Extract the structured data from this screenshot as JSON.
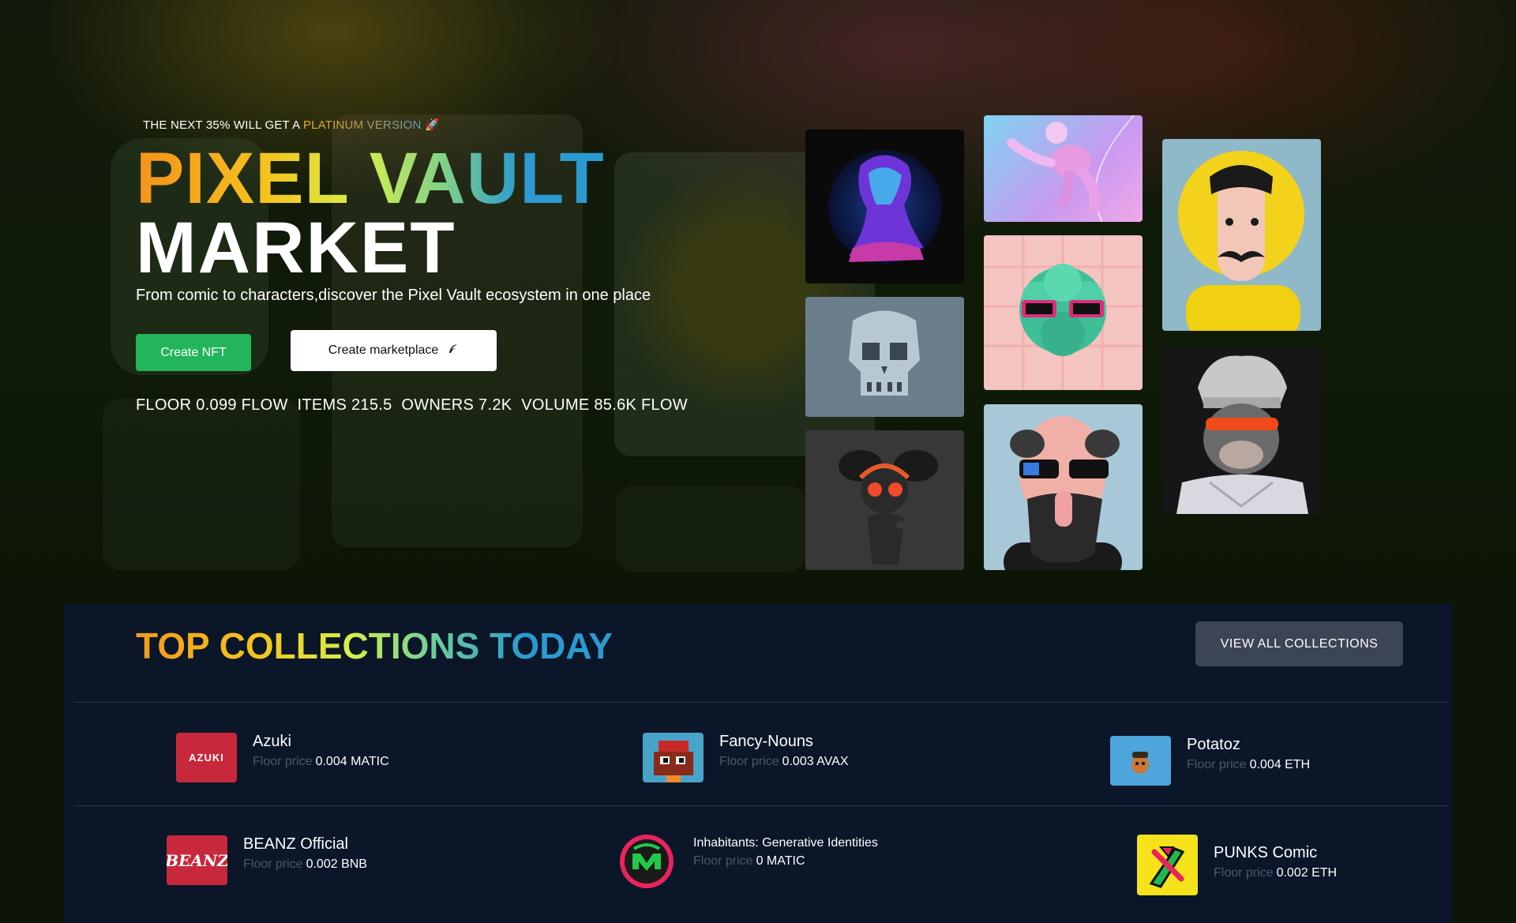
{
  "hero": {
    "promo_prefix": "THE NEXT 35% WILL GET A",
    "promo_highlight": "PLATINUM VERSION",
    "promo_emoji": "🚀",
    "title_line1": "PIXEL VAULT",
    "title_line2": "MARKET",
    "subtitle": "From comic to characters,discover the Pixel Vault ecosystem in one place",
    "create_nft_label": "Create NFT",
    "create_marketplace_label": "Create marketplace",
    "stats": {
      "floor": "FLOOR 0.099 FLOW",
      "items": "ITEMS 215.5",
      "owners": "OWNERS 7.2K",
      "volume": "VOLUME 85.6K FLOW"
    }
  },
  "artworks": [
    {
      "name": "neon-bust",
      "icon": "statue-bust-icon"
    },
    {
      "name": "astronaut",
      "icon": "astronaut-icon"
    },
    {
      "name": "mustache-yellow",
      "icon": "character-portrait-icon"
    },
    {
      "name": "pixel-skull",
      "icon": "skull-icon"
    },
    {
      "name": "broccoli-glasses",
      "icon": "broccoli-icon"
    },
    {
      "name": "headphones-girl",
      "icon": "character-figure-icon"
    },
    {
      "name": "bald-beard",
      "icon": "character-portrait-icon"
    },
    {
      "name": "chef-ape",
      "icon": "ape-portrait-icon"
    }
  ],
  "collections": {
    "title": "TOP COLLECTIONS TODAY",
    "view_all_label": "VIEW ALL COLLECTIONS",
    "floor_label": "Floor price",
    "items": [
      {
        "name": "Azuki",
        "price": "0.004 MATIC",
        "logo_text": "AZUKI",
        "color": "#c8283b"
      },
      {
        "name": "Fancy-Nouns",
        "price": "0.003 AVAX",
        "logo_text": "",
        "color": "#47a3c8"
      },
      {
        "name": "Potatoz",
        "price": "0.004 ETH",
        "logo_text": "",
        "color": "#4ea5dc"
      },
      {
        "name": "BEANZ Official",
        "price": "0.002 BNB",
        "logo_text": "BEANZ",
        "color": "#c8283b"
      },
      {
        "name": "Inhabitants: Generative Identities",
        "price": "0  MATIC",
        "logo_text": "",
        "color": "#e8245c"
      },
      {
        "name": "PUNKS Comic",
        "price": "0.002 ETH",
        "logo_text": "",
        "color": "#f4e21a"
      }
    ]
  },
  "colors": {
    "accent_green": "#22b55a",
    "collections_bg": "#0b1629",
    "view_all_bg": "#3c4553"
  }
}
